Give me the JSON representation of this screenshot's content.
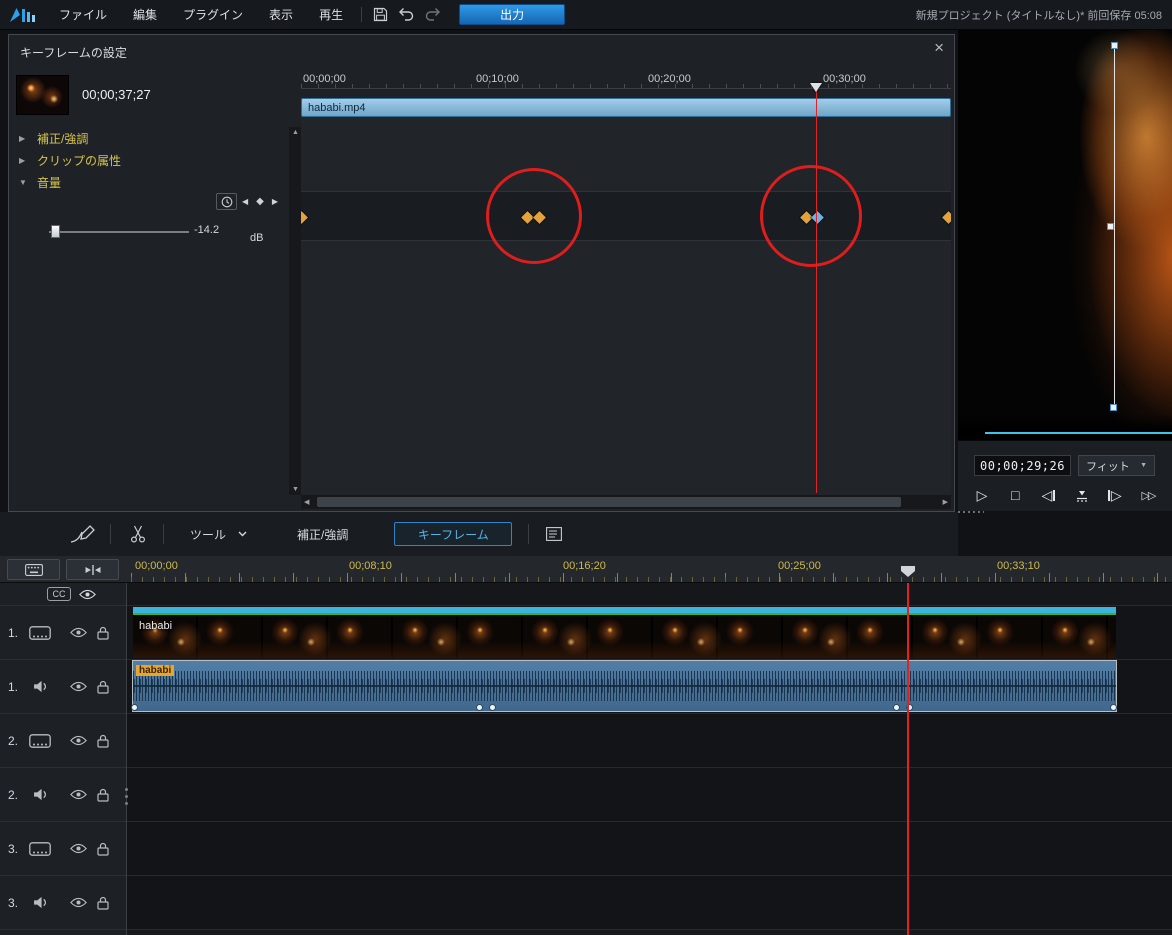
{
  "menubar": {
    "menus": [
      {
        "label": "ファイル"
      },
      {
        "label": "編集"
      },
      {
        "label": "プラグイン"
      },
      {
        "label": "表示"
      },
      {
        "label": "再生"
      }
    ],
    "output_label": "出力",
    "project_status": "新規プロジェクト (タイトルなし)* 前回保存 05:08"
  },
  "keyframe_panel": {
    "title": "キーフレームの設定",
    "thumb_timecode": "00;00;37;27",
    "tree_items": [
      {
        "label": "補正/強調"
      },
      {
        "label": "クリップの属性"
      },
      {
        "label": "音量"
      }
    ],
    "volume_value": "-14.2",
    "volume_unit": "dB",
    "ruler_labels": [
      "00;00;00",
      "00;10;00",
      "00;20;00",
      "00;30;00"
    ],
    "clip_label": "hababi.mp4"
  },
  "preview": {
    "timecode": "00;00;29;26",
    "fit_label": "フィット"
  },
  "toolbar": {
    "tools_label": "ツール",
    "fix_label": "補正/強調",
    "keyframe_label": "キーフレーム"
  },
  "timeline": {
    "cc_label": "CC",
    "ruler_labels": [
      "00;00;00",
      "00;08;10",
      "00;16;20",
      "00;25;00",
      "00;33;10"
    ],
    "video_clip_label": "hababi",
    "audio_clip_label": "hababi",
    "tracks": [
      {
        "num": "1.",
        "type": "video"
      },
      {
        "num": "1.",
        "type": "audio"
      },
      {
        "num": "2.",
        "type": "video"
      },
      {
        "num": "2.",
        "type": "audio"
      },
      {
        "num": "3.",
        "type": "video"
      },
      {
        "num": "3.",
        "type": "audio"
      }
    ]
  },
  "icons": {
    "close": "×",
    "collapsed": "▶",
    "expanded": "▼",
    "kf_prev": "◀",
    "kf_diamond": "◆",
    "kf_next": "▶",
    "dropdown": "▼",
    "play": "▷",
    "stop": "□",
    "tri_left": "◁",
    "tri_right": "▷",
    "ff": "▷▷",
    "scroll_left": "◀",
    "scroll_right": "▶",
    "scroll_up": "▲",
    "scroll_down": "▼"
  },
  "colors": {
    "accent": "#2b8fd6",
    "keyframe_orange": "#e2a23c",
    "keyframe_blue": "#6cb0e6",
    "playhead": "#e02222"
  }
}
